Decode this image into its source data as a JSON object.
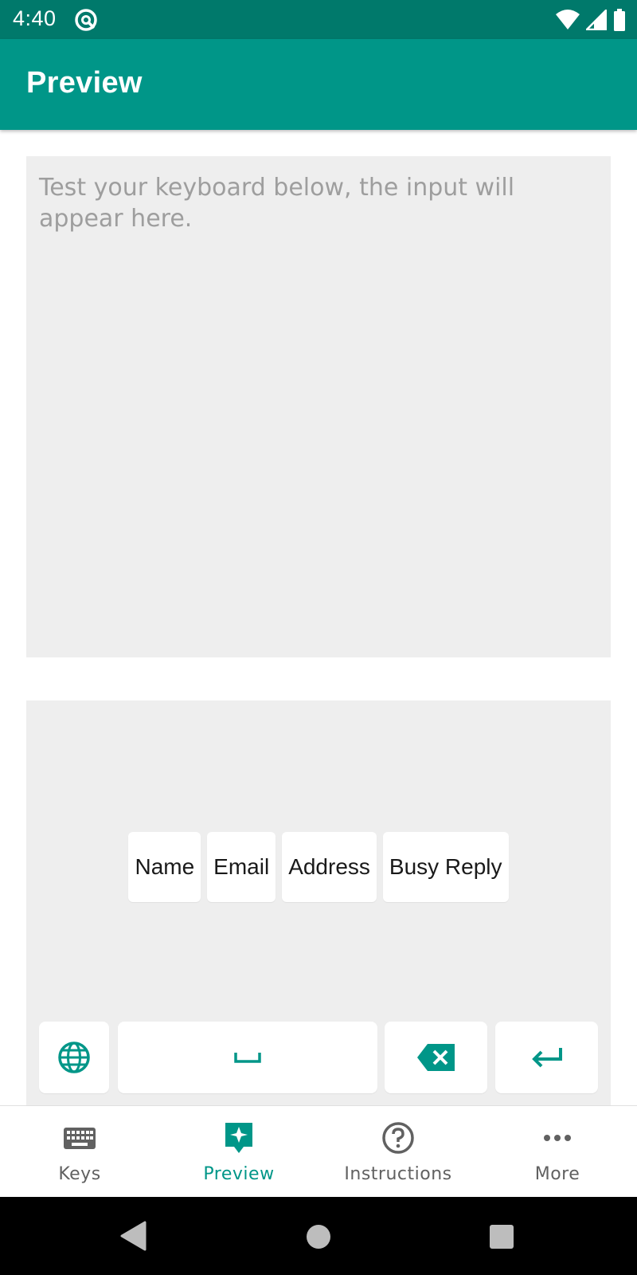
{
  "status_bar": {
    "time": "4:40",
    "icons": [
      "app-notification-icon",
      "wifi-icon",
      "signal-icon",
      "battery-icon"
    ]
  },
  "app_bar": {
    "title": "Preview"
  },
  "preview": {
    "input_value": "",
    "placeholder": "Test your keyboard below, the input will appear here."
  },
  "keyboard": {
    "chips": [
      "Name",
      "Email",
      "Address",
      "Busy Reply"
    ],
    "keys": [
      "globe-icon",
      "space-bar-icon",
      "backspace-icon",
      "enter-icon"
    ]
  },
  "bottom_nav": {
    "items": [
      {
        "label": "Keys",
        "icon": "keyboard-icon",
        "active": false
      },
      {
        "label": "Preview",
        "icon": "preview-sparkle-icon",
        "active": true
      },
      {
        "label": "Instructions",
        "icon": "help-circle-icon",
        "active": false
      },
      {
        "label": "More",
        "icon": "more-horizontal-icon",
        "active": false
      }
    ]
  },
  "colors": {
    "status_bar": "#00796b",
    "primary": "#009688",
    "surface": "#eeeeee",
    "nav_inactive": "#616161"
  }
}
